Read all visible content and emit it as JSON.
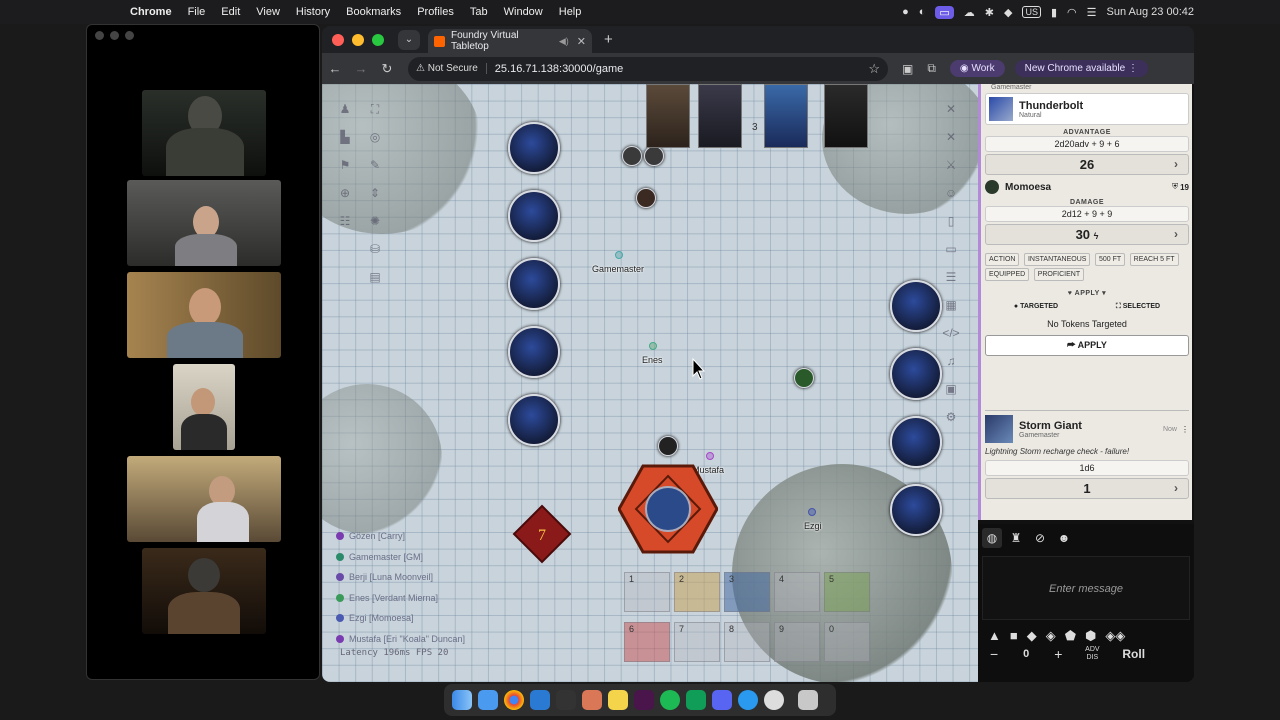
{
  "menubar": {
    "app": "Chrome",
    "items": [
      "File",
      "Edit",
      "View",
      "History",
      "Bookmarks",
      "Profiles",
      "Tab",
      "Window",
      "Help"
    ],
    "keyboard": "US",
    "clock": "Sun Aug 23  00:42"
  },
  "browser": {
    "tab_title": "Foundry Virtual Tabletop",
    "security": "Not Secure",
    "url": "25.16.71.138:30000/game",
    "profile": "Work",
    "update": "New Chrome available"
  },
  "map": {
    "tokens": {
      "gamemaster": "Gamemaster",
      "enes": "Enes",
      "mustafa": "Mustafa",
      "ezgi": "Ezgi"
    },
    "combat_tracker": {
      "round_number": "3"
    },
    "dice": {
      "d8_value": "7"
    },
    "players": [
      {
        "name": "Gözen [Carry]",
        "color": "#7a3bb0"
      },
      {
        "name": "Gamemaster [GM]",
        "color": "#2a8a6a"
      },
      {
        "name": "Berji [Luna Moonveil]",
        "color": "#6a4aa8"
      },
      {
        "name": "Enes [Verdant Mierna]",
        "color": "#3a9a5a"
      },
      {
        "name": "Ezgi [Momoesa]",
        "color": "#4a5ab0"
      },
      {
        "name": "Mustafa [Eri \"Koala\" Duncan]",
        "color": "#7a3bb0"
      }
    ],
    "latency": "Latency  196ms  FPS 20",
    "hotbar": {
      "slots": [
        "1",
        "2",
        "3",
        "4",
        "5",
        "6",
        "7",
        "8",
        "9",
        "0"
      ]
    }
  },
  "chat": {
    "card1": {
      "speaker_role": "Gamemaster",
      "item_name": "Thunderbolt",
      "item_type": "Natural",
      "attack_label": "ADVANTAGE",
      "attack_formula": "2d20adv + 9 + 6",
      "attack_total": "26",
      "target_name": "Momoesa",
      "target_ac": "19",
      "damage_label": "DAMAGE",
      "damage_formula": "2d12 + 9 + 9",
      "damage_total": "30",
      "tags": [
        "ACTION",
        "INSTANTANEOUS",
        "500 FT",
        "REACH 5 FT",
        "EQUIPPED",
        "PROFICIENT"
      ],
      "apply_label": "APPLY",
      "targeted_label": "TARGETED",
      "selected_label": "SELECTED",
      "no_targets": "No Tokens Targeted",
      "apply_button": "APPLY"
    },
    "card2": {
      "speaker": "Storm Giant",
      "role": "Gamemaster",
      "time": "Now",
      "flavor": "Lightning Storm recharge check - failure!",
      "formula": "1d6",
      "total": "1"
    },
    "input_placeholder": "Enter message",
    "modifier": "0",
    "adv_label": "ADV",
    "dis_label": "DIS",
    "roll_label": "Roll"
  }
}
